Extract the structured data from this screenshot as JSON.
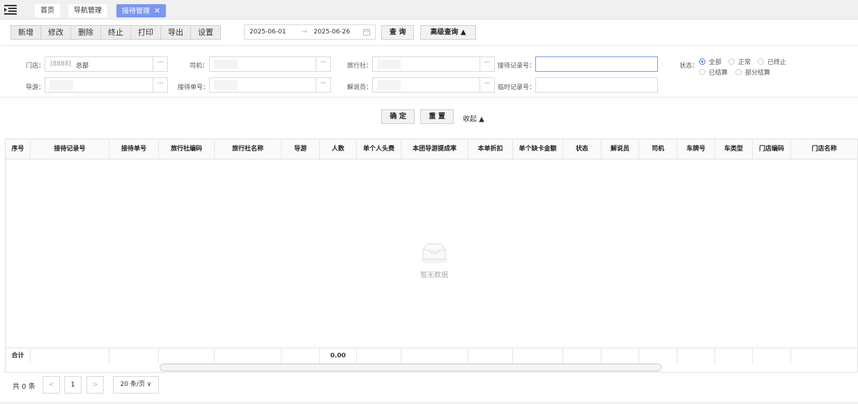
{
  "tabs": [
    {
      "label": "首页",
      "active": false,
      "closable": false
    },
    {
      "label": "导航管理",
      "active": false,
      "closable": false
    },
    {
      "label": "接待管理",
      "active": true,
      "closable": true
    }
  ],
  "toolbar": {
    "buttons": [
      "新增",
      "修改",
      "删除",
      "终止",
      "打印",
      "导出",
      "设置"
    ],
    "date_start": "2025-06-01",
    "date_sep": "→",
    "date_end": "2025-06-26",
    "query_label": "查 询",
    "advanced_label": "高级查询 ▲"
  },
  "filters": {
    "store_label": "门店：",
    "store_code": "[8888]",
    "store_name": "总部",
    "driver_label": "司机：",
    "agency_label": "旅行社：",
    "reception_no_label": "接待记录号：",
    "guide_label": "导游：",
    "order_no_label": "接待单号：",
    "narrator_label": "解说员：",
    "temp_no_label": "临时记录号：",
    "dots": "···",
    "status_label": "状态：",
    "status_options": [
      {
        "label": "全部",
        "checked": true
      },
      {
        "label": "正常",
        "checked": false
      },
      {
        "label": "已终止",
        "checked": false
      },
      {
        "label": "已结算",
        "checked": false
      },
      {
        "label": "部分结算",
        "checked": false
      }
    ]
  },
  "actions": {
    "confirm_label": "确 定",
    "reset_label": "重 置",
    "collapse_label": "收起 ▲"
  },
  "table": {
    "columns": [
      "序号",
      "接待记录号",
      "接待单号",
      "旅行社编码",
      "旅行社名称",
      "导游",
      "人数",
      "单个人头费",
      "本团导游提成率",
      "本单折扣",
      "单个缺卡金额",
      "状态",
      "解说员",
      "司机",
      "车牌号",
      "车类型",
      "门店编码",
      "门店名称"
    ],
    "empty_text": "暂无数据",
    "total_label": "合计",
    "total_people": "0.00"
  },
  "pager": {
    "total_text": "共 0 条",
    "prev": "<",
    "page": "1",
    "next": ">",
    "page_size": "20 条/页 ∨"
  },
  "colors": {
    "active_tab": "#7b97f0",
    "radio_checked": "#3b7ae0"
  }
}
